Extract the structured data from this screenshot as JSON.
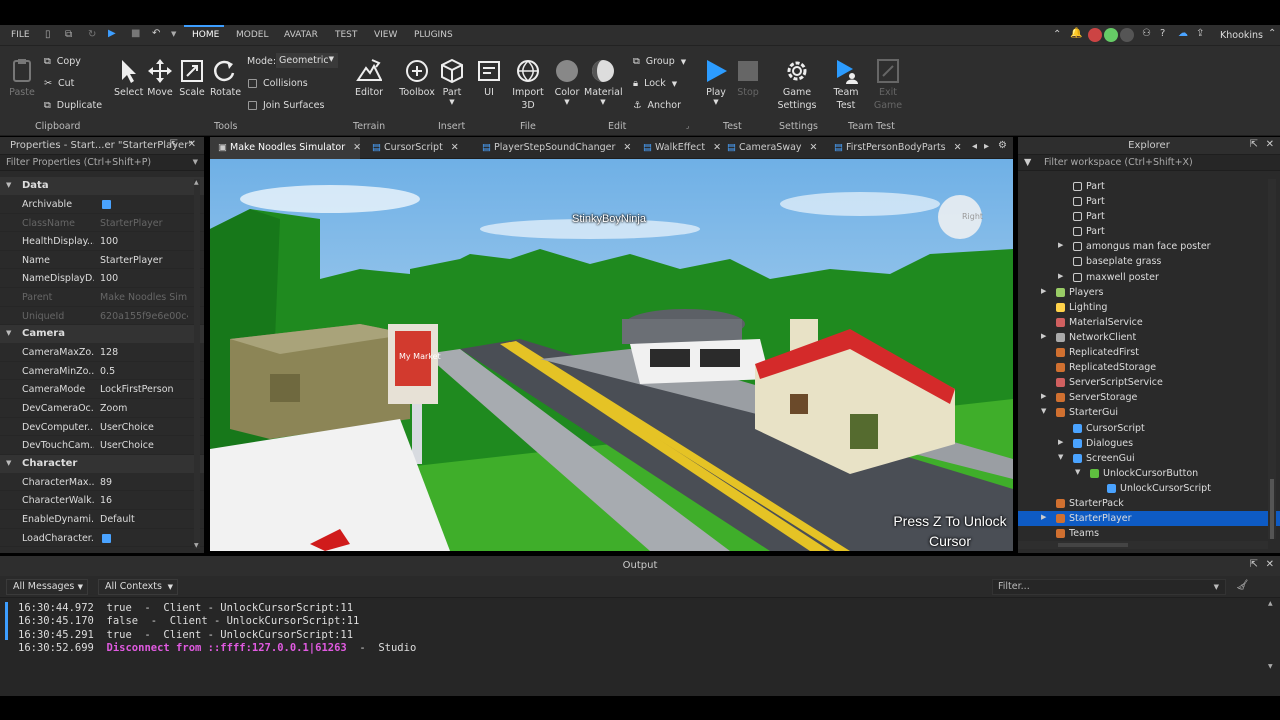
{
  "menubar": {
    "file": "FILE",
    "tabs": [
      "HOME",
      "MODEL",
      "AVATAR",
      "TEST",
      "VIEW",
      "PLUGINS"
    ],
    "user": "Khookins"
  },
  "ribbon": {
    "clipboard": {
      "paste": "Paste",
      "copy": "Copy",
      "cut": "Cut",
      "duplicate": "Duplicate",
      "group": "Clipboard"
    },
    "tools": {
      "select": "Select",
      "move": "Move",
      "scale": "Scale",
      "rotate": "Rotate",
      "mode_label": "Mode:",
      "mode_value": "Geometric",
      "collisions": "Collisions",
      "join": "Join Surfaces",
      "group": "Tools"
    },
    "terrain": {
      "editor": "Editor",
      "group": "Terrain"
    },
    "insert": {
      "toolbox": "Toolbox",
      "part": "Part",
      "ui": "UI",
      "group": "Insert"
    },
    "file": {
      "import": "Import",
      "import2": "3D",
      "group": "File"
    },
    "edit": {
      "color": "Color",
      "material": "Material",
      "group_btn": "Group",
      "lock": "Lock",
      "anchor": "Anchor",
      "group": "Edit"
    },
    "test": {
      "play": "Play",
      "stop": "Stop",
      "group": "Test"
    },
    "settings": {
      "game": "Game",
      "game2": "Settings",
      "group": "Settings"
    },
    "team": {
      "team": "Team",
      "team2": "Test",
      "exit": "Exit",
      "exit2": "Game",
      "group": "Team Test"
    }
  },
  "properties": {
    "title": "Properties - Start...er \"StarterPlayer\"",
    "filter": "Filter Properties (Ctrl+Shift+P)",
    "sections": [
      {
        "name": "Data",
        "rows": [
          {
            "k": "Archivable",
            "v": "",
            "check": true
          },
          {
            "k": "ClassName",
            "v": "StarterPlayer",
            "dim": true
          },
          {
            "k": "HealthDisplay...",
            "v": "100"
          },
          {
            "k": "Name",
            "v": "StarterPlayer"
          },
          {
            "k": "NameDisplayD...",
            "v": "100"
          },
          {
            "k": "Parent",
            "v": "Make Noodles Sim...",
            "dim": true
          },
          {
            "k": "UniqueId",
            "v": "620a155f9e6e00c4...",
            "dim": true
          }
        ]
      },
      {
        "name": "Camera",
        "rows": [
          {
            "k": "CameraMaxZo...",
            "v": "128"
          },
          {
            "k": "CameraMinZo...",
            "v": "0.5"
          },
          {
            "k": "CameraMode",
            "v": "LockFirstPerson"
          },
          {
            "k": "DevCameraOc...",
            "v": "Zoom"
          },
          {
            "k": "DevComputer...",
            "v": "UserChoice"
          },
          {
            "k": "DevTouchCam...",
            "v": "UserChoice"
          }
        ]
      },
      {
        "name": "Character",
        "rows": [
          {
            "k": "CharacterMax...",
            "v": "89"
          },
          {
            "k": "CharacterWalk...",
            "v": "16"
          },
          {
            "k": "EnableDynami...",
            "v": "Default"
          },
          {
            "k": "LoadCharacter...",
            "v": "",
            "check": true
          }
        ]
      }
    ]
  },
  "tabs": [
    "Make Noodles Simulator",
    "CursorScript",
    "PlayerStepSoundChanger",
    "WalkEffect",
    "CameraSway",
    "FirstPersonBodyParts"
  ],
  "viewport": {
    "player_name": "StinkyBoyNinja",
    "hint_line1": "Press Z To Unlock",
    "hint_line2": "Cursor",
    "sign_text": "My Market",
    "cube_label": "Right"
  },
  "explorer": {
    "title": "Explorer",
    "filter": "Filter workspace (Ctrl+Shift+X)",
    "items": [
      {
        "label": "Part",
        "indent": 2,
        "icon": "part",
        "arrow": ""
      },
      {
        "label": "Part",
        "indent": 2,
        "icon": "part",
        "arrow": ""
      },
      {
        "label": "Part",
        "indent": 2,
        "icon": "part",
        "arrow": ""
      },
      {
        "label": "Part",
        "indent": 2,
        "icon": "part",
        "arrow": ""
      },
      {
        "label": "amongus man face poster",
        "indent": 2,
        "icon": "part",
        "arrow": "▶"
      },
      {
        "label": "baseplate grass",
        "indent": 2,
        "icon": "part",
        "arrow": ""
      },
      {
        "label": "maxwell poster",
        "indent": 2,
        "icon": "part",
        "arrow": "▶"
      },
      {
        "label": "Players",
        "indent": 1,
        "icon": "players",
        "arrow": "▶"
      },
      {
        "label": "Lighting",
        "indent": 1,
        "icon": "lighting",
        "arrow": ""
      },
      {
        "label": "MaterialService",
        "indent": 1,
        "icon": "service",
        "arrow": ""
      },
      {
        "label": "NetworkClient",
        "indent": 1,
        "icon": "network",
        "arrow": "▶"
      },
      {
        "label": "ReplicatedFirst",
        "indent": 1,
        "icon": "folder-red",
        "arrow": ""
      },
      {
        "label": "ReplicatedStorage",
        "indent": 1,
        "icon": "folder-red",
        "arrow": ""
      },
      {
        "label": "ServerScriptService",
        "indent": 1,
        "icon": "service",
        "arrow": ""
      },
      {
        "label": "ServerStorage",
        "indent": 1,
        "icon": "folder-red",
        "arrow": "▶"
      },
      {
        "label": "StarterGui",
        "indent": 1,
        "icon": "folder-red",
        "arrow": "▼"
      },
      {
        "label": "CursorScript",
        "indent": 2,
        "icon": "script",
        "arrow": ""
      },
      {
        "label": "Dialogues",
        "indent": 2,
        "icon": "screengui",
        "arrow": "▶"
      },
      {
        "label": "ScreenGui",
        "indent": 2,
        "icon": "screengui",
        "arrow": "▼"
      },
      {
        "label": "UnlockCursorButton",
        "indent": 3,
        "icon": "button",
        "arrow": "▼"
      },
      {
        "label": "UnlockCursorScript",
        "indent": 4,
        "icon": "script",
        "arrow": ""
      },
      {
        "label": "StarterPack",
        "indent": 1,
        "icon": "folder-red",
        "arrow": ""
      },
      {
        "label": "StarterPlayer",
        "indent": 1,
        "icon": "folder-red",
        "arrow": "▶",
        "selected": true
      },
      {
        "label": "Teams",
        "indent": 1,
        "icon": "folder-red",
        "arrow": ""
      }
    ]
  },
  "output": {
    "title": "Output",
    "messages_filter": "All Messages",
    "contexts_filter": "All Contexts",
    "filter_placeholder": "Filter...",
    "lines": [
      {
        "text": "16:30:44.972  true  -  Client - UnlockCursorScript:11",
        "type": "normal"
      },
      {
        "text": "16:30:45.170  false  -  Client - UnlockCursorScript:11",
        "type": "normal"
      },
      {
        "text": "16:30:45.291  true  -  Client - UnlockCursorScript:11",
        "type": "normal"
      },
      {
        "ts": "16:30:52.699",
        "err": "Disconnect from ::ffff:127.0.0.1|61263",
        "tail": "  -  Studio",
        "type": "error"
      }
    ]
  },
  "colors": {
    "accent": "#3d9eff",
    "selected": "#0e5bc4",
    "error": "#e15ae1"
  }
}
